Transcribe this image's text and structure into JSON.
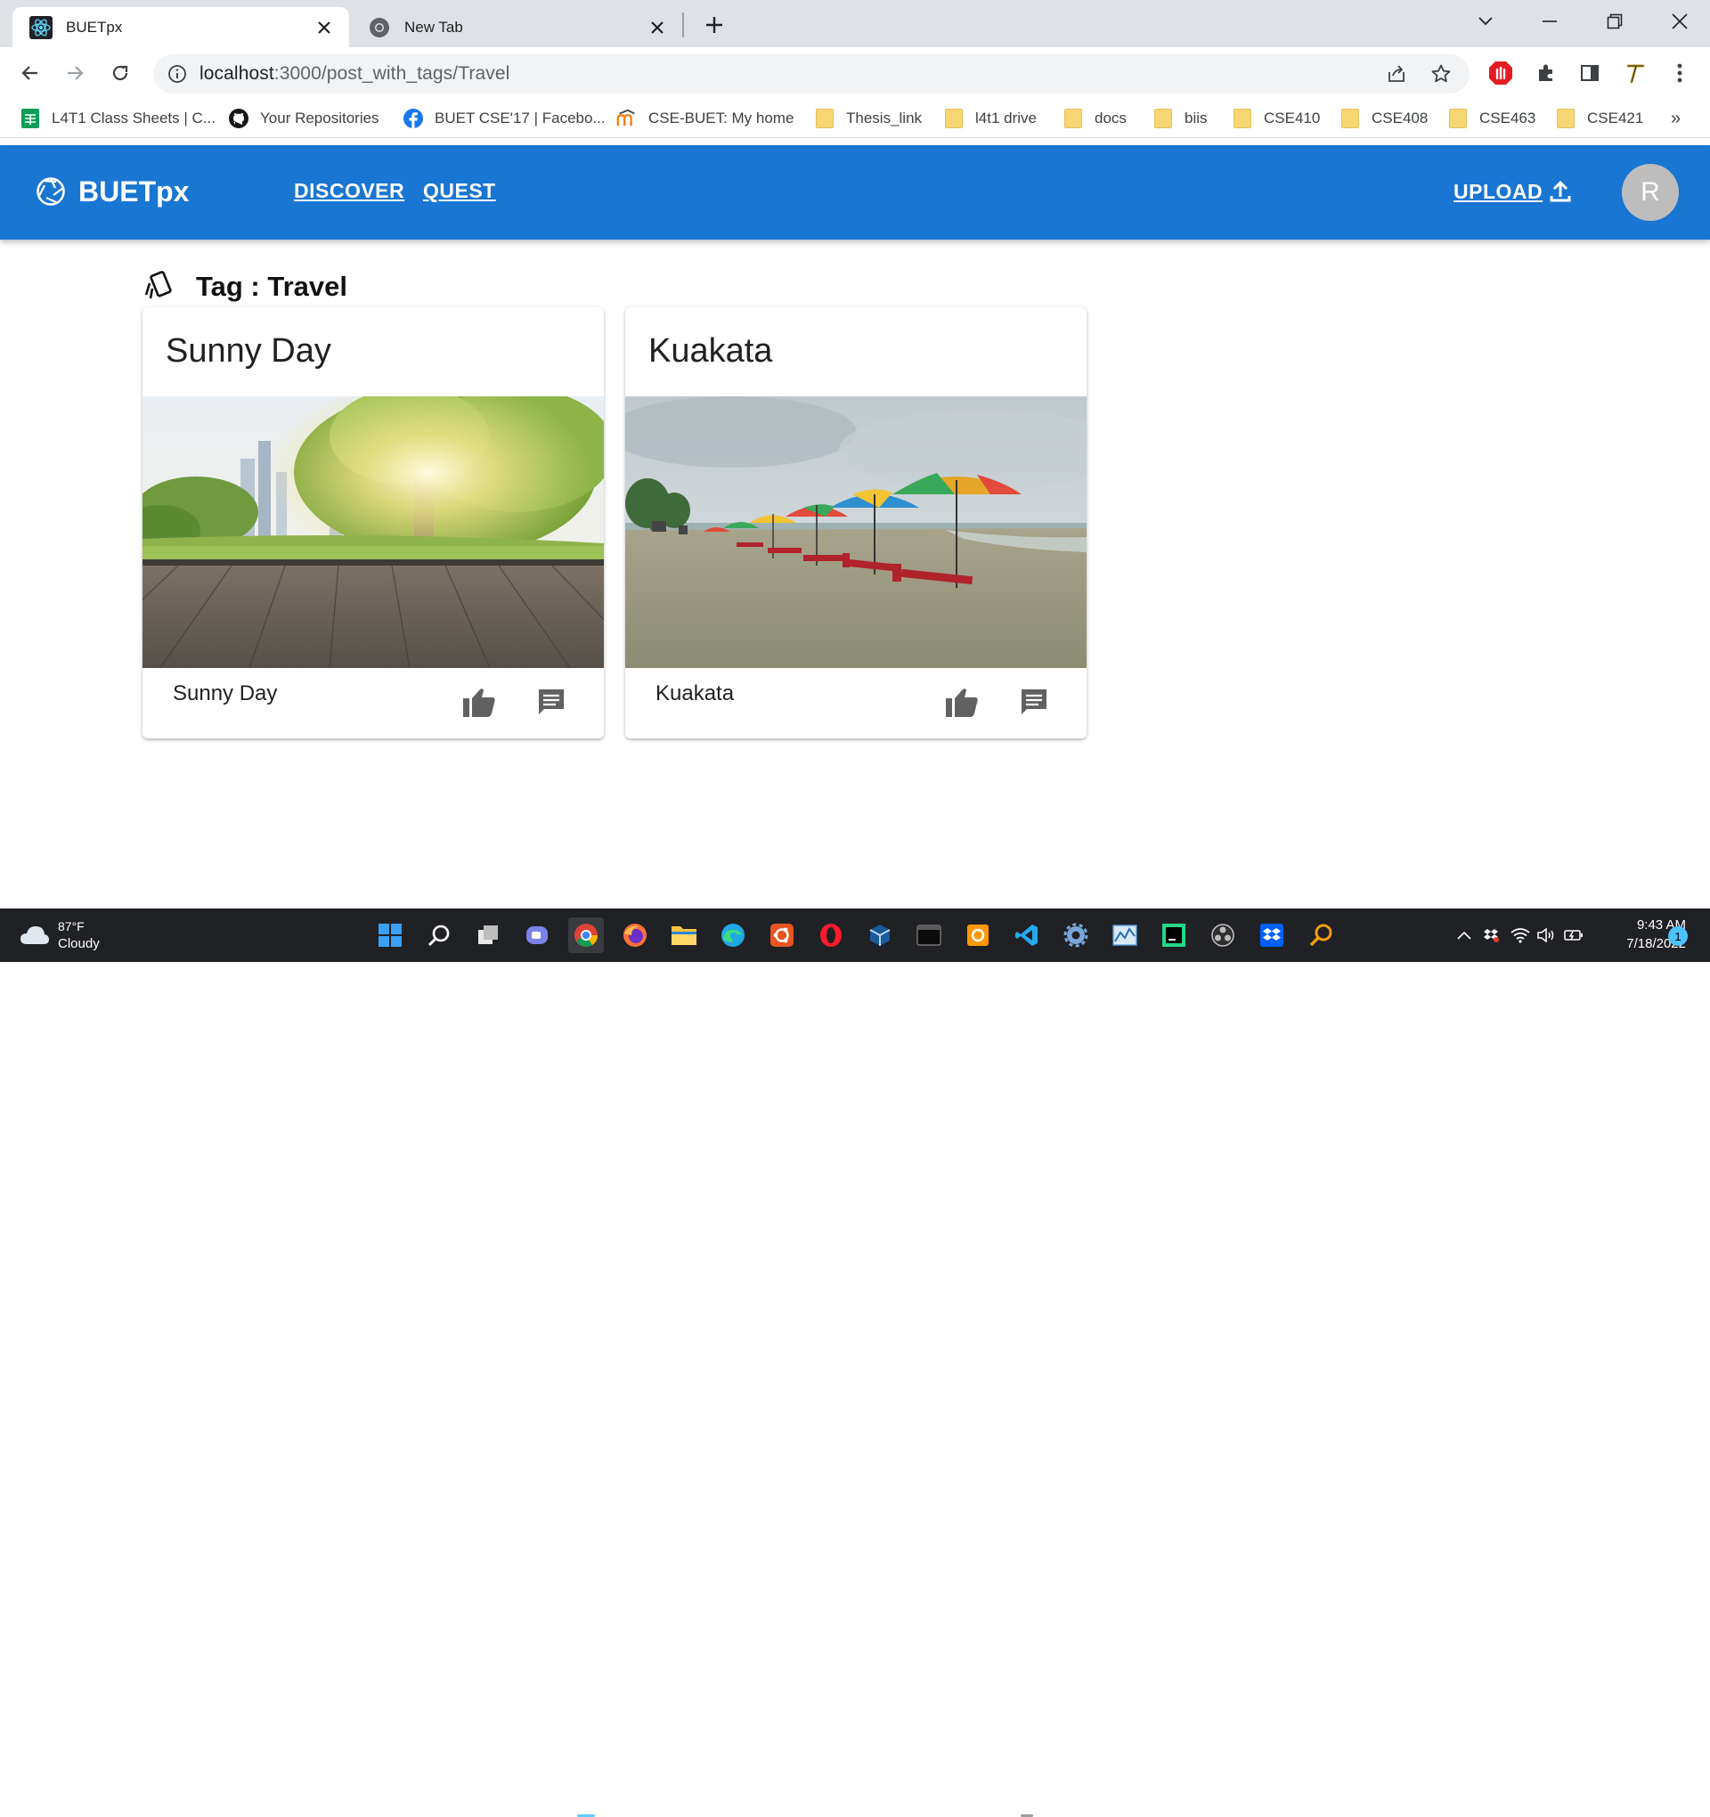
{
  "browser": {
    "tabs": [
      {
        "title": "BUETpx",
        "icon": "react-icon",
        "active": true
      },
      {
        "title": "New Tab",
        "icon": "chrome-icon",
        "active": false
      }
    ],
    "url": {
      "host": "localhost",
      "path": ":3000/post_with_tags/Travel"
    },
    "bookmarks": [
      {
        "label": "L4T1 Class Sheets | C...",
        "icon": "sheets-icon"
      },
      {
        "label": "Your Repositories",
        "icon": "github-icon"
      },
      {
        "label": "BUET CSE'17 | Facebo...",
        "icon": "facebook-icon"
      },
      {
        "label": "CSE-BUET: My home",
        "icon": "moodle-icon"
      },
      {
        "label": "Thesis_link",
        "icon": "folder-icon"
      },
      {
        "label": "l4t1 drive",
        "icon": "folder-icon"
      },
      {
        "label": "docs",
        "icon": "folder-icon"
      },
      {
        "label": "biis",
        "icon": "folder-icon"
      },
      {
        "label": "CSE410",
        "icon": "folder-icon"
      },
      {
        "label": "CSE408",
        "icon": "folder-icon"
      },
      {
        "label": "CSE463",
        "icon": "folder-icon"
      },
      {
        "label": "CSE421",
        "icon": "folder-icon"
      }
    ],
    "bookmarks_overflow": "»"
  },
  "app": {
    "brand": "BUETpx",
    "nav": {
      "discover": "DISCOVER",
      "quest": "QUEST"
    },
    "upload_label": "UPLOAD",
    "avatar_initial": "R",
    "accent_color": "#1976d2"
  },
  "tag_page": {
    "heading": "Tag : Travel",
    "posts": [
      {
        "title": "Sunny Day",
        "caption": "Sunny Day",
        "image": "park-with-tree-and-wooden-deck"
      },
      {
        "title": "Kuakata",
        "caption": "Kuakata",
        "image": "beach-with-colorful-umbrellas"
      }
    ]
  },
  "taskbar": {
    "weather": {
      "temp": "87°F",
      "condition": "Cloudy"
    },
    "clock": {
      "time": "9:43 AM",
      "date": "7/18/2022"
    },
    "notification_count": "1"
  }
}
